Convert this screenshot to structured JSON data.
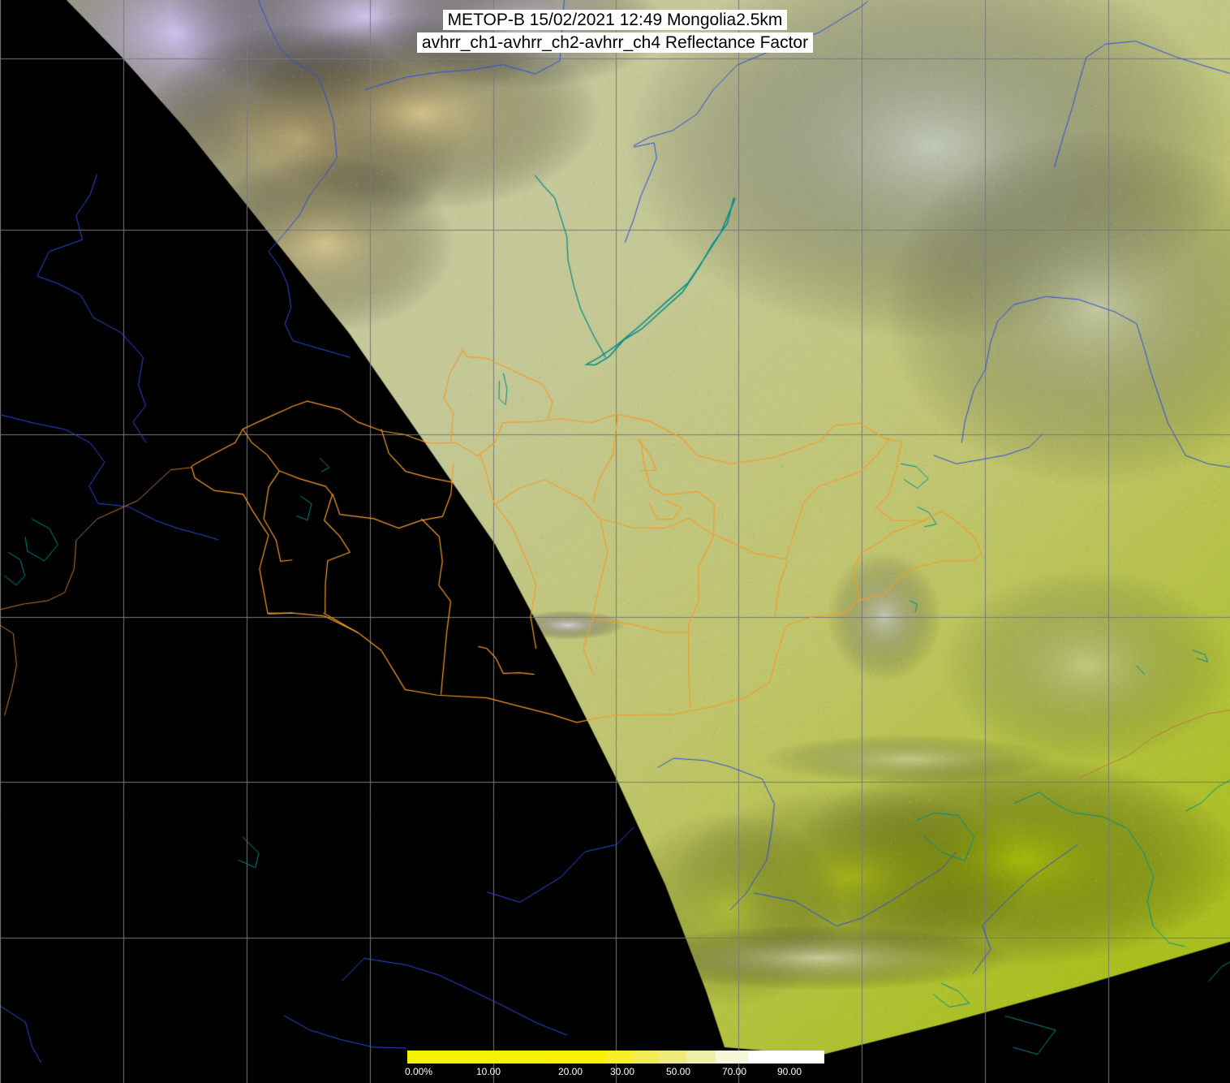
{
  "title": {
    "line1": "METOP-B 15/02/2021 12:49 Mongolia2.5km",
    "line2": "avhrr_ch1-avhrr_ch2-avhrr_ch4 Reflectance Factor"
  },
  "colorbar": {
    "labels": [
      "0.00%",
      "10.00",
      "20.00",
      "30.00",
      "50.00",
      "70.00",
      "90.00"
    ],
    "colors": [
      "#f3f300",
      "#f5f200",
      "#f8f200",
      "#f6ef2a",
      "#f1ec56",
      "#eeeb7b",
      "#efeeaa",
      "#f6f6d8",
      "#ffffff"
    ]
  },
  "map": {
    "background": "#000000",
    "gridline_color": "#7a7a7a",
    "coastline_color": "#008c8c",
    "river_color": "#2a4ee0",
    "province_border_color": "#f39c2c",
    "country_border_color": "#c2773a",
    "image_colors": {
      "cloud_lavender": "#d0c4f4",
      "cloud_tan": "#dcc68a",
      "land_pale_green": "#c6cc94",
      "land_yellow_green": "#b8c44a",
      "land_bright_green": "#a6be00"
    }
  }
}
